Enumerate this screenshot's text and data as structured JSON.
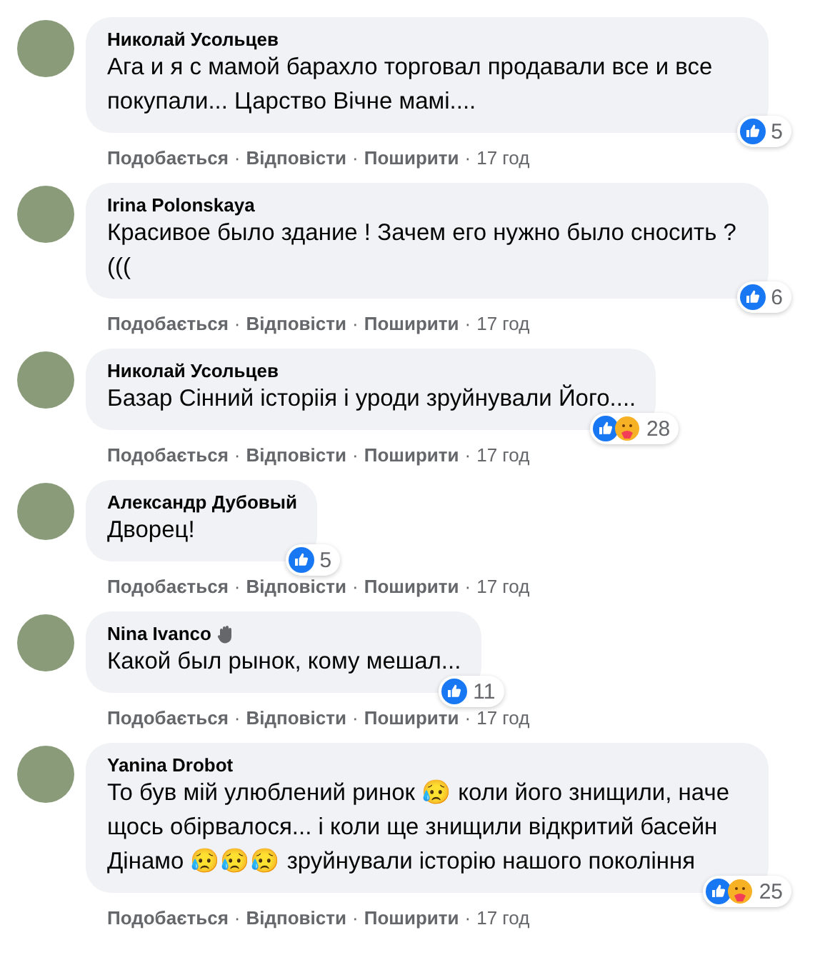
{
  "comments": [
    {
      "author": "Николай Усольцев",
      "badge": false,
      "text": "Ага и я с мамой барахло торговал продавали все и все покупали... Царство Вічне мамі....",
      "reactions": [
        {
          "kind": "like"
        }
      ],
      "count": "5",
      "actions": [
        {
          "kind": "link",
          "text": "Подобається"
        },
        {
          "kind": "dot",
          "text": "·"
        },
        {
          "kind": "link",
          "text": "Відповісти"
        },
        {
          "kind": "dot",
          "text": "·"
        },
        {
          "kind": "link",
          "text": "Поширити"
        },
        {
          "kind": "dot",
          "text": "·"
        },
        {
          "kind": "time",
          "text": "17 год"
        }
      ]
    },
    {
      "author": "Irina Polonskaya",
      "badge": false,
      "text": "Красивое было здание ! Зачем его нужно было сносить ?(((",
      "reactions": [
        {
          "kind": "like"
        }
      ],
      "count": "6",
      "actions": [
        {
          "kind": "link",
          "text": "Подобається"
        },
        {
          "kind": "dot",
          "text": "·"
        },
        {
          "kind": "link",
          "text": "Відповісти"
        },
        {
          "kind": "dot",
          "text": "·"
        },
        {
          "kind": "link",
          "text": "Поширити"
        },
        {
          "kind": "dot",
          "text": "·"
        },
        {
          "kind": "time",
          "text": "17 год"
        }
      ]
    },
    {
      "author": "Николай Усольцев",
      "badge": false,
      "text": "Базар Сінний історіія і уроди зруйнували Його....",
      "reactions": [
        {
          "kind": "like"
        },
        {
          "kind": "care"
        }
      ],
      "count": "28",
      "actions": [
        {
          "kind": "link",
          "text": "Подобається"
        },
        {
          "kind": "dot",
          "text": "·"
        },
        {
          "kind": "link",
          "text": "Відповісти"
        },
        {
          "kind": "dot",
          "text": "·"
        },
        {
          "kind": "link",
          "text": "Поширити"
        },
        {
          "kind": "dot",
          "text": "·"
        },
        {
          "kind": "time",
          "text": "17 год"
        }
      ]
    },
    {
      "author": "Александр Дубовый",
      "badge": false,
      "text": "Дворец!",
      "reactions": [
        {
          "kind": "like"
        }
      ],
      "count": "5",
      "actions": [
        {
          "kind": "link",
          "text": "Подобається"
        },
        {
          "kind": "dot",
          "text": "·"
        },
        {
          "kind": "link",
          "text": "Відповісти"
        },
        {
          "kind": "dot",
          "text": "·"
        },
        {
          "kind": "link",
          "text": "Поширити"
        },
        {
          "kind": "dot",
          "text": "·"
        },
        {
          "kind": "time",
          "text": "17 год"
        }
      ]
    },
    {
      "author": "Nina Ivanco",
      "badge": true,
      "text": "Какой был рынок, кому мешал...",
      "reactions": [
        {
          "kind": "like"
        }
      ],
      "count": "11",
      "actions": [
        {
          "kind": "link",
          "text": "Подобається"
        },
        {
          "kind": "dot",
          "text": "·"
        },
        {
          "kind": "link",
          "text": "Відповісти"
        },
        {
          "kind": "dot",
          "text": "·"
        },
        {
          "kind": "link",
          "text": "Поширити"
        },
        {
          "kind": "dot",
          "text": "·"
        },
        {
          "kind": "time",
          "text": "17 год"
        }
      ]
    },
    {
      "author": "Yanina Drobot",
      "badge": false,
      "text": "То був мій улюблений ринок 😥 коли його знищили, наче щось обірвалося... і коли ще знищили відкритий басейн Дінамо 😥😥😥 зруйнували історію нашого покоління",
      "reactions": [
        {
          "kind": "like"
        },
        {
          "kind": "care"
        }
      ],
      "count": "25",
      "actions": [
        {
          "kind": "link",
          "text": "Подобається"
        },
        {
          "kind": "dot",
          "text": "·"
        },
        {
          "kind": "link",
          "text": "Відповісти"
        },
        {
          "kind": "dot",
          "text": "·"
        },
        {
          "kind": "link",
          "text": "Поширити"
        },
        {
          "kind": "dot",
          "text": "·"
        },
        {
          "kind": "time",
          "text": "17 год"
        }
      ]
    }
  ]
}
